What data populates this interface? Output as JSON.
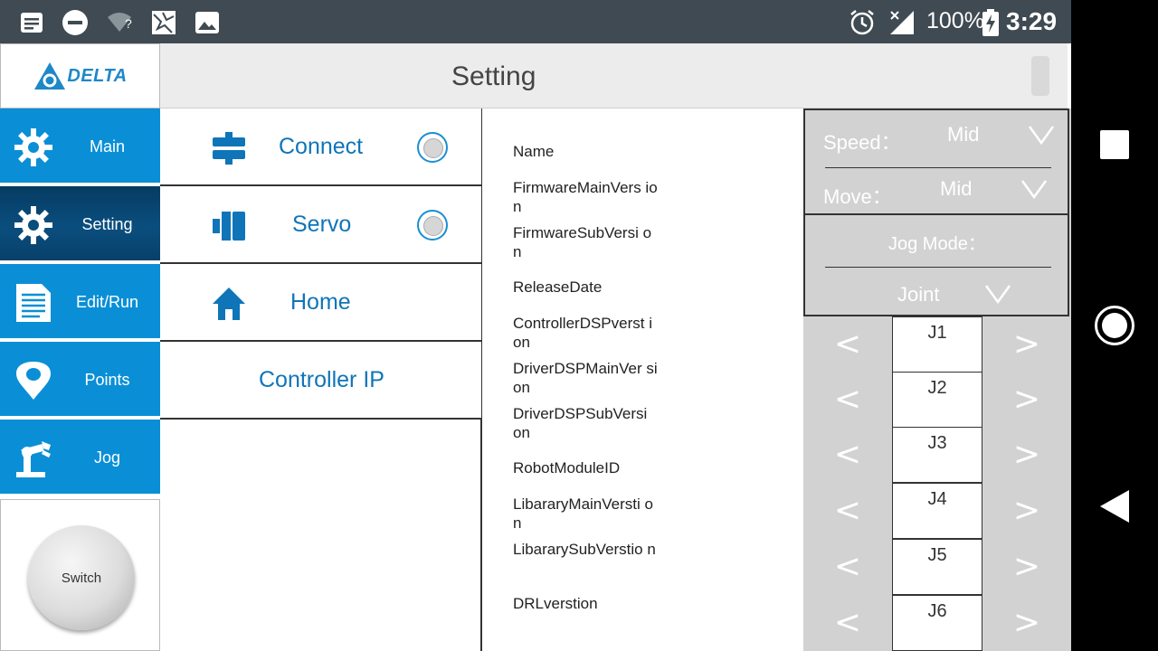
{
  "status_bar": {
    "battery": "100%",
    "time": "3:29",
    "wifi_badge": "?",
    "left_icons": [
      "notes-icon",
      "dnd-icon",
      "wifi-question-icon",
      "gallery-puzzle-icon",
      "image-icon"
    ],
    "right_icons": [
      "alarm-icon",
      "no-signal-icon",
      "battery-charging-icon"
    ]
  },
  "app": {
    "logo_text": "DELTA",
    "title": "Setting"
  },
  "sidebar": {
    "items": [
      {
        "label": "Main",
        "icon": "gear-icon",
        "active": false
      },
      {
        "label": "Setting",
        "icon": "gear-icon",
        "active": true
      },
      {
        "label": "Edit/Run",
        "icon": "document-icon",
        "active": false
      },
      {
        "label": "Points",
        "icon": "location-pin-icon",
        "active": false
      },
      {
        "label": "Jog",
        "icon": "robot-arm-icon",
        "active": false
      }
    ],
    "switch_label": "Switch"
  },
  "setting_menu": {
    "connect": "Connect",
    "servo": "Servo",
    "home": "Home",
    "controller_ip": "Controller IP"
  },
  "info_fields": [
    "Name",
    "FirmwareMainVers ion",
    "FirmwareSubVersi on",
    "ReleaseDate",
    "ControllerDSPverst ion",
    "DriverDSPMainVer sion",
    "DriverDSPSubVersi on",
    "RobotModuleID",
    "LibararyMainVersti on",
    "LibararySubVerstio n",
    "DRLverstion"
  ],
  "jog_panel": {
    "speed_label": "Speed：",
    "speed_value": "Mid",
    "move_label": "Move：",
    "move_value": "Mid",
    "jog_mode_label": "Jog Mode：",
    "jog_mode_value": "Joint",
    "left_arrow": "<",
    "right_arrow": ">",
    "joints": [
      "J1",
      "J2",
      "J3",
      "J4",
      "J5",
      "J6"
    ]
  },
  "colors": {
    "status_bar": "#3f4a52",
    "sidebar_blue": "#0a8fd6",
    "sidebar_active": "#0a4e7e",
    "accent_text": "#0f75b8",
    "panel_gray": "#d2d2d2"
  }
}
